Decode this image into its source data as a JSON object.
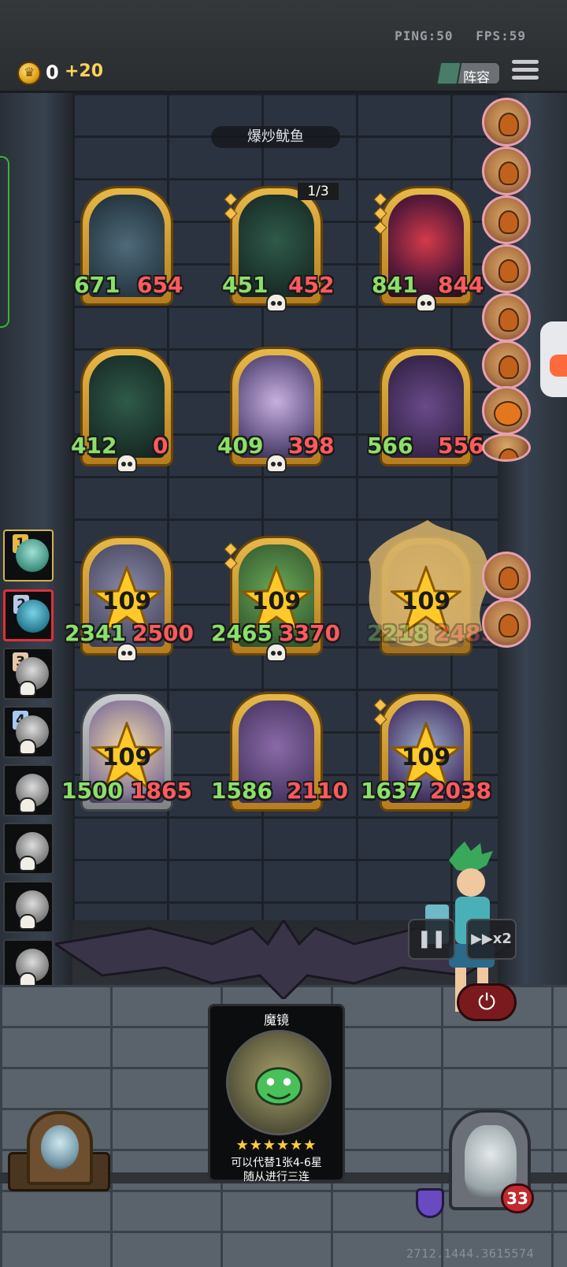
{
  "header": {
    "ping": "PING:50",
    "fps": "FPS:59",
    "gold": "0",
    "gold_income": "+20",
    "lineup_label": "阵容"
  },
  "opponent": {
    "name": "爆炒鱿鱼",
    "hero_health": "33"
  },
  "board": {
    "enemy_row1": [
      {
        "name": "dragon-minion",
        "attack": "671",
        "health": "654",
        "tier_diamonds": 0
      },
      {
        "name": "ghost-coffin-minion",
        "attack": "451",
        "health": "452",
        "counter": "1/3"
      },
      {
        "name": "clown-minion",
        "attack": "841",
        "health": "844"
      }
    ],
    "enemy_row2": [
      {
        "name": "ghost-coffin-minion",
        "attack": "412",
        "health": "0"
      },
      {
        "name": "spirit-girl-minion",
        "attack": "409",
        "health": "398"
      },
      {
        "name": "dragon-minion",
        "attack": "566",
        "health": "556"
      }
    ],
    "player_row1": [
      {
        "name": "witch-minion",
        "level": "109",
        "attack": "2341",
        "health": "2500"
      },
      {
        "name": "tree-minion",
        "level": "109",
        "attack": "2465",
        "health": "3370"
      },
      {
        "name": "splashed-minion",
        "level": "109",
        "attack": "2218",
        "health": "2485"
      }
    ],
    "player_row2": [
      {
        "name": "angel-minion",
        "level": "109",
        "attack": "1500",
        "health": "1865"
      },
      {
        "name": "bat-minion",
        "level": "109",
        "attack": "1586",
        "health": "2110"
      },
      {
        "name": "serpent-minion",
        "level": "109",
        "attack": "1637",
        "health": "2038"
      }
    ]
  },
  "ranking": [
    {
      "rank": "1"
    },
    {
      "rank": "2"
    },
    {
      "rank": "3"
    },
    {
      "rank": "4"
    },
    {
      "rank": ""
    },
    {
      "rank": ""
    },
    {
      "rank": ""
    },
    {
      "rank": ""
    }
  ],
  "controls": {
    "pause": "❚❚",
    "speed": "▶▶x2"
  },
  "spell_card": {
    "title": "魔镜",
    "stars": "★★★★★★",
    "desc_line1": "可以代替1张4-6星",
    "desc_line2": "随从进行三连"
  },
  "seed": "2712.1444.3615574",
  "colors": {
    "attack": "#8be06a",
    "health": "#ff5a5e",
    "gold_frame": "#e6b84a",
    "accent_green": "#3ab33a"
  }
}
